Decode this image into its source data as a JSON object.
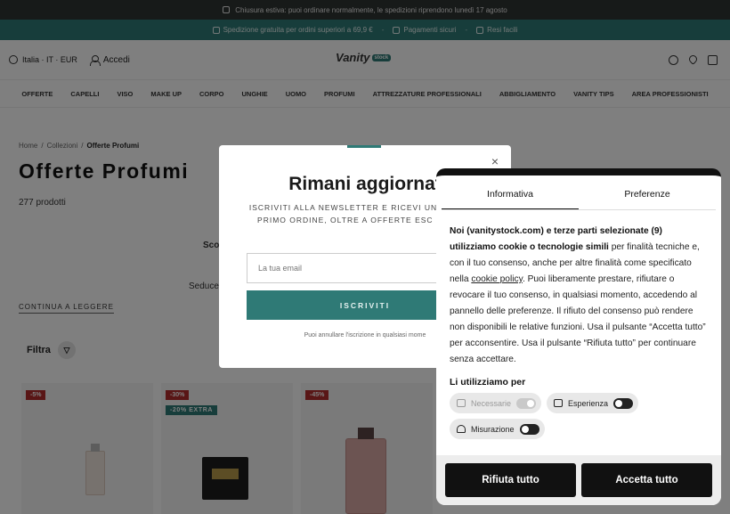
{
  "topbar": {
    "announcement": "Chiusura estiva: puoi ordinare normalmente, le spedizioni riprendono lunedì 17 agosto",
    "perks": [
      "Spedizione gratuita per ordini superiori a 69,9 €",
      "Pagamenti sicuri",
      "Resi facili"
    ],
    "separator": "-"
  },
  "header": {
    "locale": "Italia · IT · EUR",
    "login": "Accedi",
    "logo_text": "Vanity",
    "logo_badge": "stock"
  },
  "nav": [
    "OFFERTE",
    "CAPELLI",
    "VISO",
    "MAKE UP",
    "CORPO",
    "UNGHIE",
    "UOMO",
    "PROFUMI",
    "ATTREZZATURE PROFESSIONALI",
    "ABBIGLIAMENTO",
    "VANITY TIPS",
    "AREA PROFESSIONISTI"
  ],
  "breadcrumb": {
    "home": "Home",
    "sep": "/",
    "collections": "Collezioni",
    "current": "Offerte Profumi"
  },
  "collection": {
    "title": "Offerte Profumi",
    "count": "277 prodotti",
    "desc_line1": "Sco",
    "desc_line2": "Seduce",
    "read_more": "CONTINUA A LEGGERE",
    "filter": "Filtra"
  },
  "products": [
    {
      "badge": "-5%"
    },
    {
      "badge": "-30%",
      "badge2": "-20% EXTRA"
    },
    {
      "badge": "-45%"
    }
  ],
  "newsletter": {
    "close": "×",
    "title": "Rimani aggiornat",
    "text": "ISCRIVITI ALLA NEWSLETTER E RICEVI UNO SC TUO PRIMO ORDINE, OLTRE A OFFERTE ESC NOVITÀ.",
    "placeholder": "La tua email",
    "button": "ISCRIVITI",
    "footer": "Puoi annullare l'iscrizione in qualsiasi mome"
  },
  "cookie": {
    "tabs": [
      "Informativa",
      "Preferenze"
    ],
    "bold_intro": "Noi (vanitystock.com) e terze parti selezionate (9) utilizziamo cookie o tecnologie simili",
    "text_a": " per finalità tecniche e, con il tuo consenso, anche per altre finalità come specificato nella ",
    "link": "cookie policy",
    "text_b": ". Puoi liberamente prestare, rifiutare o revocare il tuo consenso, in qualsiasi momento, accedendo al pannello delle preferenze. Il rifiuto del consenso può rendere non disponibili le relative funzioni. Usa il pulsante “Accetta tutto” per acconsentire. Usa il pulsante “Rifiuta tutto” per continuare senza accettare.",
    "subtitle": "Li utilizziamo per",
    "pills": [
      "Necessarie",
      "Esperienza",
      "Misurazione"
    ],
    "reject": "Rifiuta tutto",
    "accept": "Accetta tutto"
  },
  "colors": {
    "teal": "#2f7a76",
    "dark": "#2f3433",
    "sale_red": "#b22c2c"
  }
}
